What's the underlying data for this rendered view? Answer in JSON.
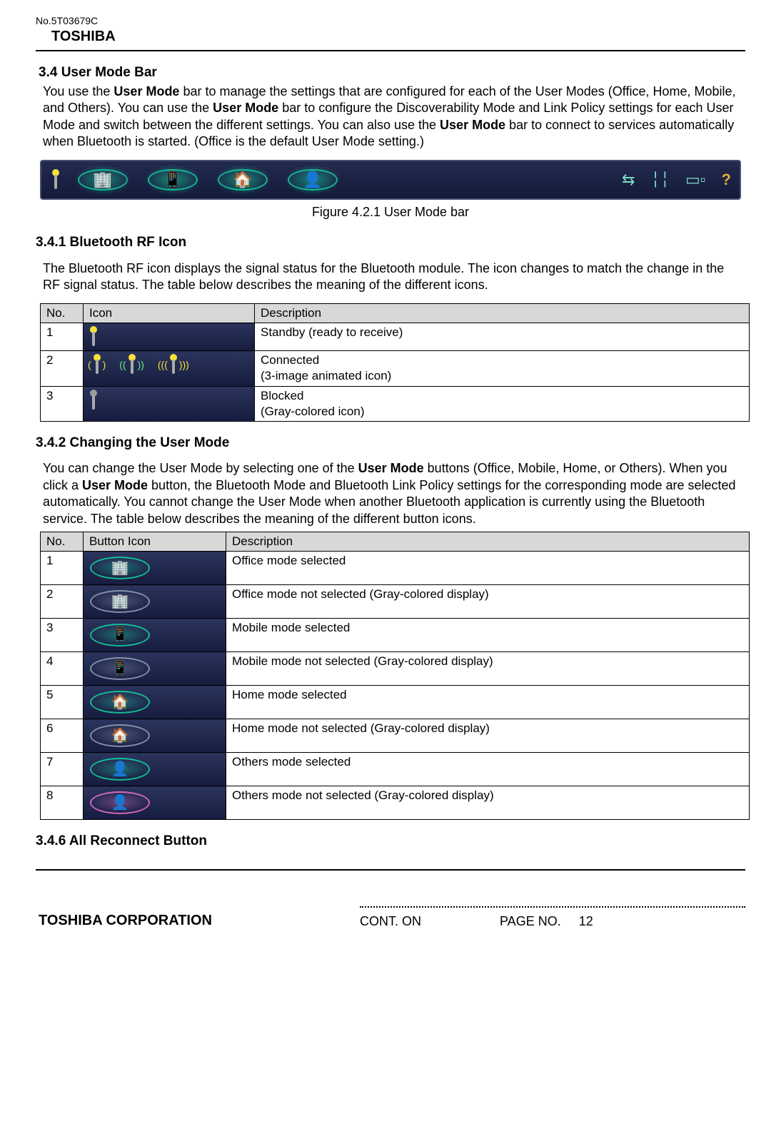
{
  "doc": {
    "number": "No.5T03679C",
    "brand": "TOSHIBA"
  },
  "sec34": {
    "heading": "3.4 User Mode Bar",
    "para_before_bold1": "You use the ",
    "bold1": "User Mode",
    "para_mid1": " bar to manage the settings that are configured for each of the User Modes (Office, Home, Mobile, and Others). You can use the ",
    "bold2": "User Mode",
    "para_mid2": " bar to configure the Discoverability Mode and Link Policy settings for each User Mode and switch between the different settings. You can also use the ",
    "bold3": "User Mode",
    "para_after": " bar to connect to services automatically when Bluetooth is started. (Office is the default User Mode setting.)"
  },
  "figure_caption": "Figure 4.2.1 User Mode bar",
  "sec341": {
    "heading": "3.4.1 Bluetooth RF Icon",
    "para": "The Bluetooth RF icon displays the signal status for the Bluetooth module. The icon changes to match the change in the RF signal status. The table below describes the meaning of the different icons."
  },
  "table1": {
    "headers": {
      "no": "No.",
      "icon": "Icon",
      "desc": "Description"
    },
    "rows": [
      {
        "no": "1",
        "desc": "Standby (ready to receive)"
      },
      {
        "no": "2",
        "desc": "Connected\n(3-image animated icon)"
      },
      {
        "no": "3",
        "desc": "Blocked\n(Gray-colored icon)"
      }
    ]
  },
  "sec342": {
    "heading": "3.4.2 Changing the User Mode",
    "para_p1": "You can change the User Mode by selecting one of the ",
    "bold1": "User Mode",
    "para_p2": " buttons (Office, Mobile, Home, or Others). When you click a ",
    "bold2": "User Mode",
    "para_p3": " button, the Bluetooth Mode and Bluetooth Link Policy settings for the corresponding mode are selected automatically. You cannot change the User Mode when another Bluetooth application is currently using the Bluetooth service. The table below describes the meaning of the different button icons."
  },
  "table2": {
    "headers": {
      "no": "No.",
      "icon": "Button Icon",
      "desc": "Description"
    },
    "rows": [
      {
        "no": "1",
        "desc": "Office mode selected"
      },
      {
        "no": "2",
        "desc": "Office mode not selected (Gray-colored display)"
      },
      {
        "no": "3",
        "desc": "Mobile mode selected"
      },
      {
        "no": "4",
        "desc": "Mobile mode not selected (Gray-colored display)"
      },
      {
        "no": "5",
        "desc": "Home mode selected"
      },
      {
        "no": "6",
        "desc": "Home mode not selected (Gray-colored display)"
      },
      {
        "no": "7",
        "desc": "Others mode selected"
      },
      {
        "no": "8",
        "desc": "Others mode not selected (Gray-colored display)"
      }
    ]
  },
  "sec346": {
    "heading": "3.4.6 All Reconnect Button"
  },
  "footer": {
    "corp": "TOSHIBA CORPORATION",
    "cont": "CONT. ON",
    "page_label": "PAGE NO.",
    "page_no": "12"
  }
}
